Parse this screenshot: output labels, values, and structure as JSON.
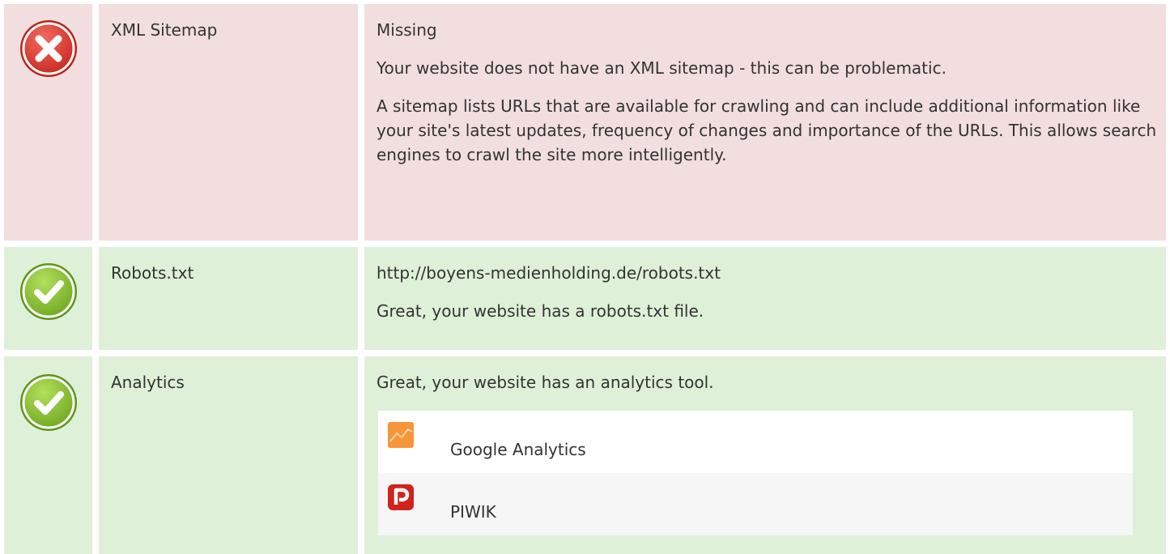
{
  "rows": [
    {
      "status": "error",
      "label": "XML Sitemap",
      "paragraphs": [
        "Missing",
        "Your website does not have an XML sitemap - this can be problematic.",
        "A sitemap lists URLs that are available for crawling and can include additional information like your site's latest updates, frequency of changes and importance of the URLs. This allows search engines to crawl the site more intelligently."
      ]
    },
    {
      "status": "ok",
      "label": "Robots.txt",
      "paragraphs": [
        "http://boyens-medienholding.de/robots.txt",
        "Great, your website has a robots.txt file."
      ]
    },
    {
      "status": "ok",
      "label": "Analytics",
      "paragraphs": [
        "Great, your website has an analytics tool."
      ],
      "tools": [
        {
          "name": "Google Analytics",
          "icon": "google-analytics-icon"
        },
        {
          "name": "PIWIK",
          "icon": "piwik-icon"
        }
      ]
    }
  ],
  "colors": {
    "error_bg": "#f2dede",
    "ok_bg": "#dff0d8",
    "error_icon": "#d9443a",
    "ok_icon": "#8cc63f"
  }
}
